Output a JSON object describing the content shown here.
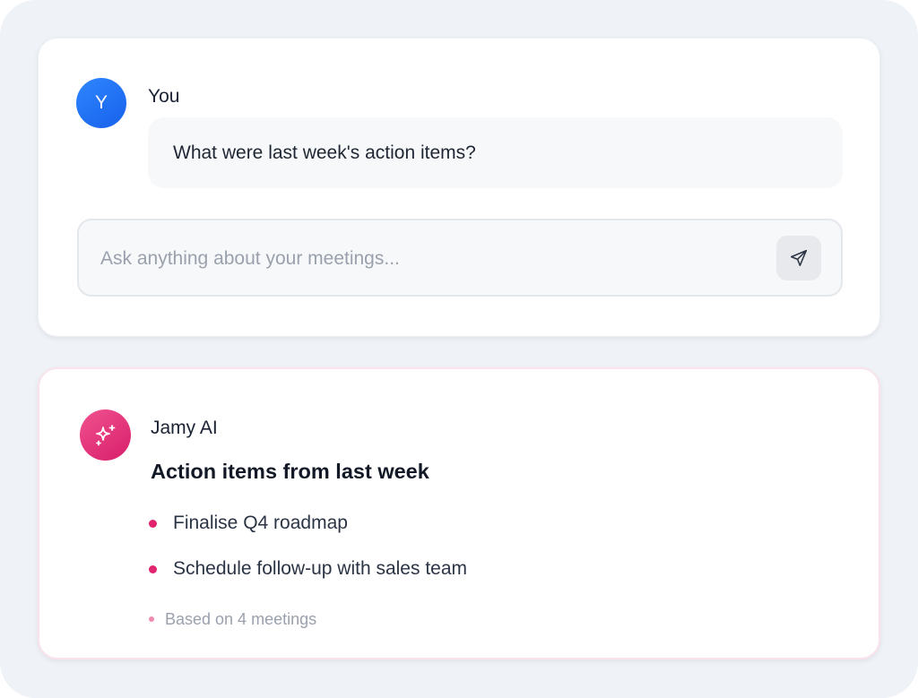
{
  "user_message": {
    "avatar_initial": "Y",
    "sender": "You",
    "text": "What were last week's action items?"
  },
  "composer": {
    "placeholder": "Ask anything about your meetings...",
    "value": "",
    "send_icon": "send-icon"
  },
  "ai_response": {
    "sender": "Jamy AI",
    "avatar_icon": "sparkle-icon",
    "title": "Action items from last week",
    "items": [
      {
        "text": "Finalise Q4 roadmap"
      },
      {
        "text": "Schedule follow-up with sales team"
      }
    ],
    "footnote": "Based on 4 meetings"
  },
  "colors": {
    "user_avatar": "#1f6ff5",
    "ai_accent": "#e0246e",
    "background": "#eff2f7"
  }
}
